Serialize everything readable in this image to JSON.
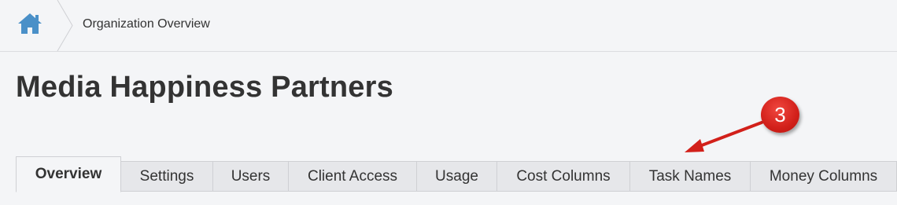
{
  "breadcrumb": {
    "home_icon": "home-icon",
    "current": "Organization Overview"
  },
  "page": {
    "title": "Media Happiness Partners"
  },
  "annotation": {
    "number": "3",
    "color": "#d2201a"
  },
  "tabs": [
    {
      "label": "Overview",
      "active": true
    },
    {
      "label": "Settings",
      "active": false
    },
    {
      "label": "Users",
      "active": false
    },
    {
      "label": "Client Access",
      "active": false
    },
    {
      "label": "Usage",
      "active": false
    },
    {
      "label": "Cost Columns",
      "active": false
    },
    {
      "label": "Task Names",
      "active": false
    },
    {
      "label": "Money Columns",
      "active": false
    }
  ],
  "colors": {
    "home_icon": "#4a90c8",
    "background": "#f4f5f7",
    "tab_inactive": "#e6e7ea"
  }
}
